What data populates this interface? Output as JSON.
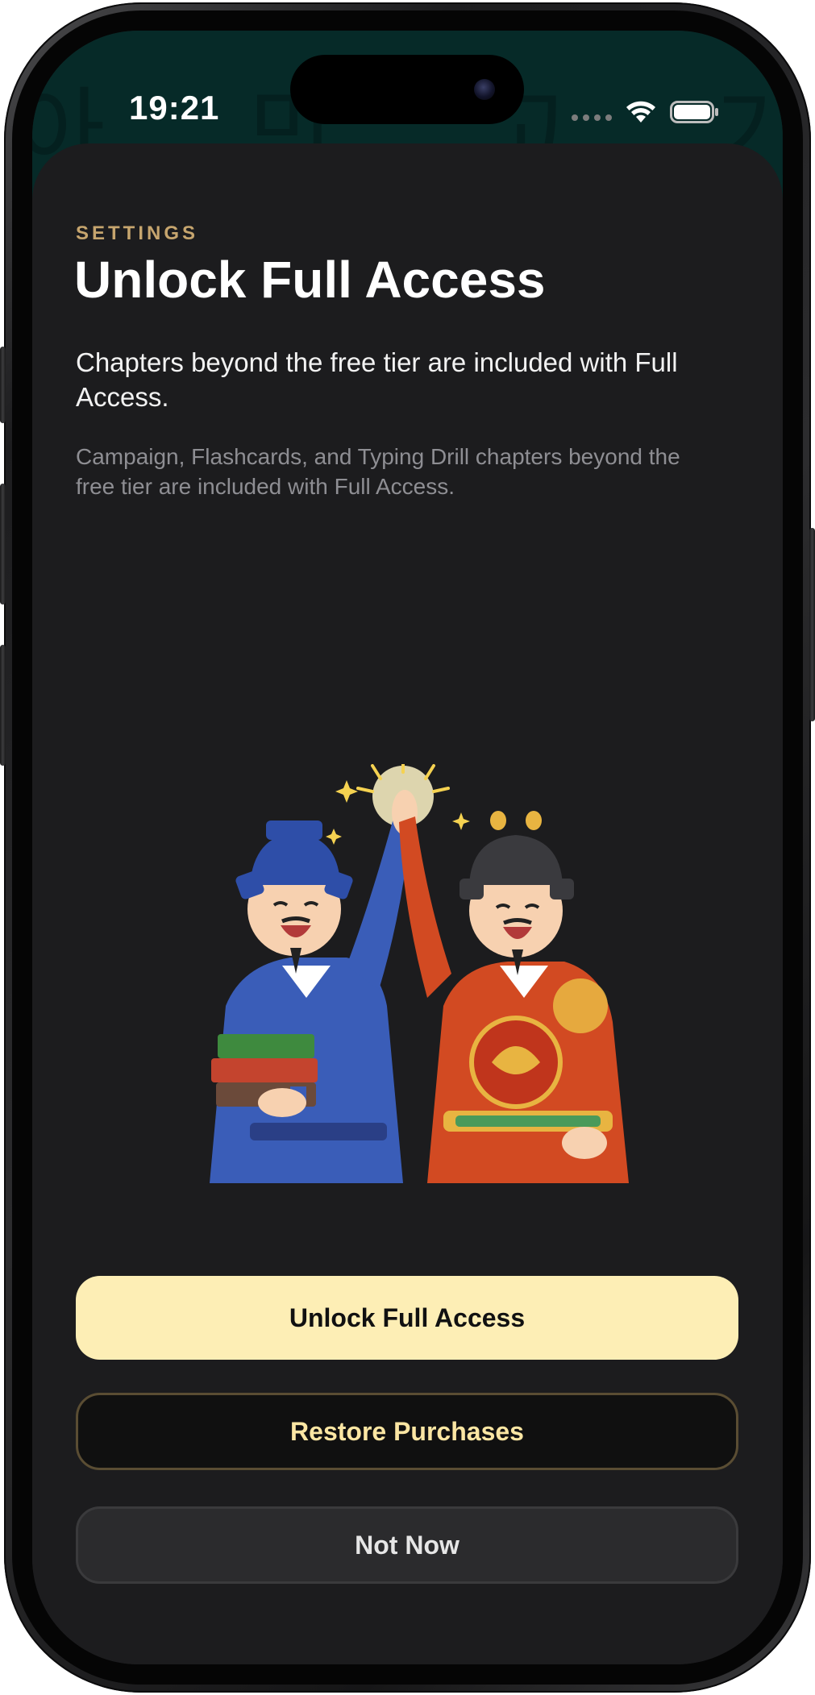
{
  "status_bar": {
    "time": "19:21"
  },
  "background": {
    "glyphs": "아 만 고 기",
    "top_color": "#062a28"
  },
  "sheet": {
    "eyebrow": "SETTINGS",
    "title": "Unlock Full Access",
    "subtitle": "Chapters beyond the free tier are included with Full Access.",
    "note": "Campaign, Flashcards, and Typing Drill chapters beyond the free tier are included with Full Access."
  },
  "illustration": {
    "subject": "two-scholars-high-five"
  },
  "actions": {
    "primary_label": "Unlock Full Access",
    "restore_label": "Restore Purchases",
    "dismiss_label": "Not Now"
  },
  "colors": {
    "accent": "#c6a56e",
    "primary_button": "#fdeeb5",
    "restore_text": "#fbe6a3",
    "sheet_bg": "#1c1c1e"
  },
  "icons": [
    "wifi-icon",
    "battery-icon",
    "signal-dots-icon"
  ]
}
